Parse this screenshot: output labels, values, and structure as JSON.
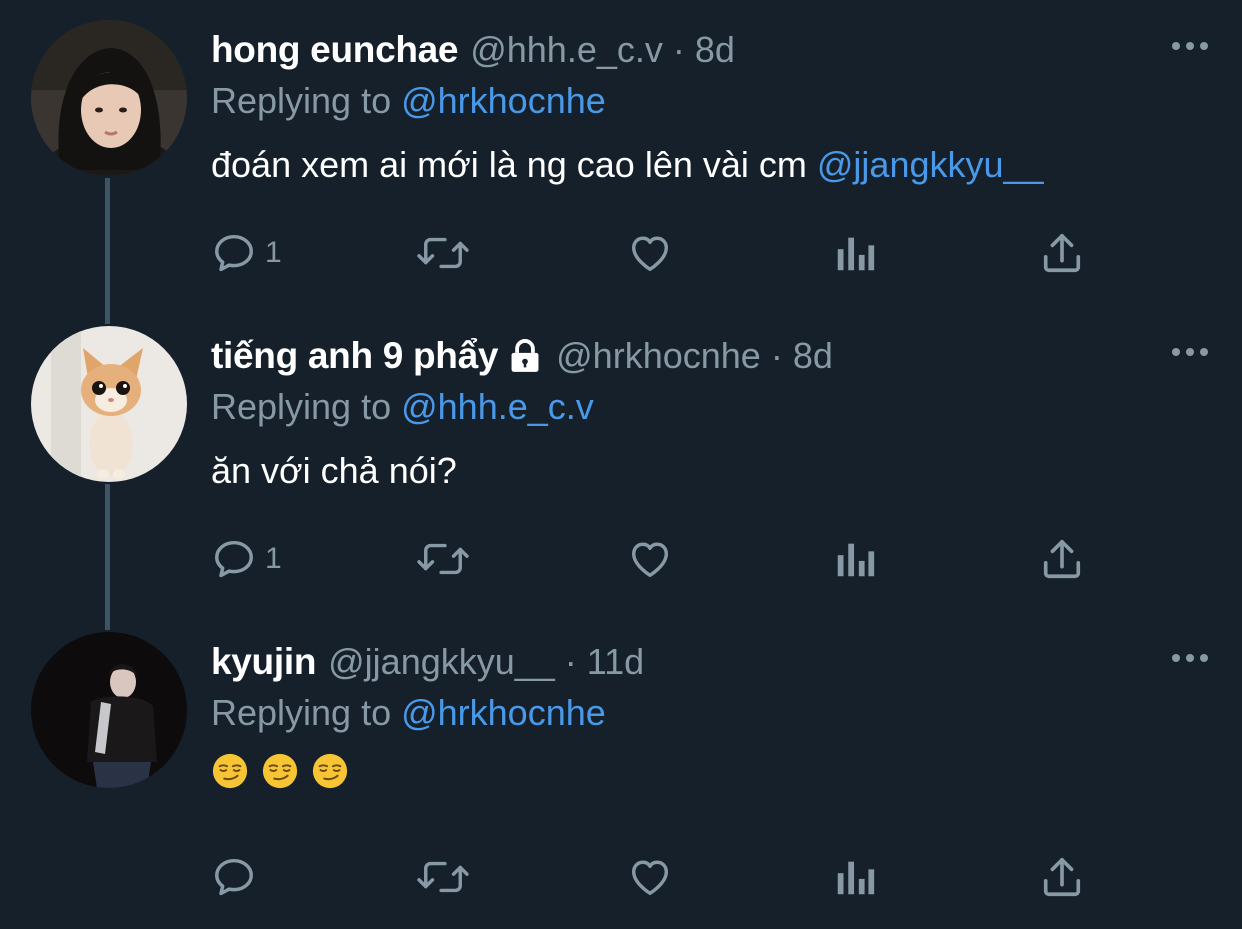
{
  "tweets": [
    {
      "name": "hong eunchae",
      "handle": "@hhh.e_c.v",
      "dot": "·",
      "time": "8d",
      "replying_prefix": "Replying to ",
      "replying_to": "@hrkhocnhe",
      "text": "đoán xem ai mới là ng cao lên vài cm ",
      "text_mention": "@jjangkkyu__",
      "reply_count": "1",
      "locked": false,
      "avatar_icon": "avatar-photo-girl"
    },
    {
      "name": "tiếng anh 9 phẩy",
      "handle": "@hrkhocnhe",
      "dot": "·",
      "time": "8d",
      "replying_prefix": "Replying to ",
      "replying_to": "@hhh.e_c.v",
      "text": "ăn với chả nói?",
      "text_mention": "",
      "reply_count": "1",
      "locked": true,
      "avatar_icon": "avatar-photo-kitten"
    },
    {
      "name": "kyujin",
      "handle": "@jjangkkyu__",
      "dot": "·",
      "time": "11d",
      "replying_prefix": "Replying to ",
      "replying_to": "@hrkhocnhe",
      "emojis": [
        "smirking-face-emoji",
        "smirking-face-emoji",
        "smirking-face-emoji"
      ],
      "reply_count": "",
      "locked": false,
      "avatar_icon": "avatar-photo-dark"
    }
  ],
  "icons": {
    "reply": "reply-icon",
    "retweet": "retweet-icon",
    "like": "heart-icon",
    "analytics": "analytics-icon",
    "share": "share-icon",
    "more": "more-icon",
    "lock": "lock-icon"
  },
  "colors": {
    "background": "#15202b",
    "secondary_text": "#8899a6",
    "link": "#4a99e9",
    "thread_line": "#3d5466"
  }
}
